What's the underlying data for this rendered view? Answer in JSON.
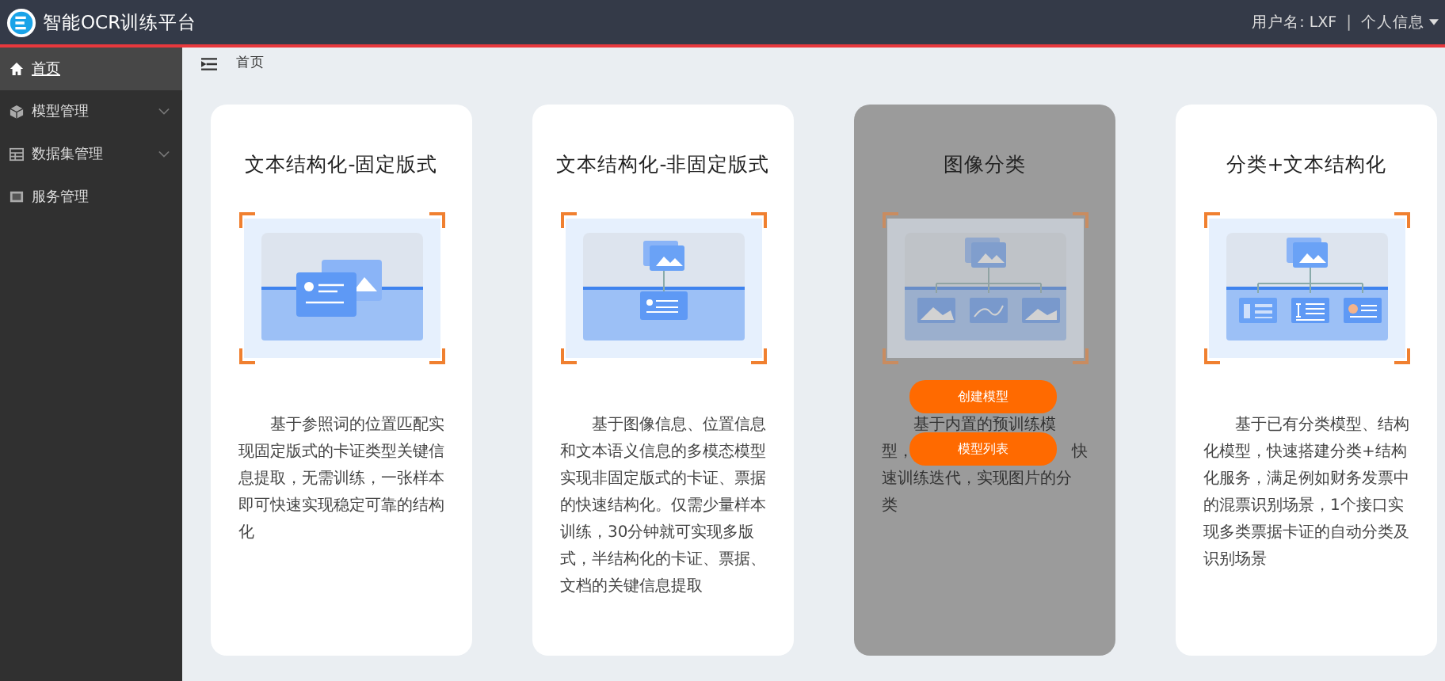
{
  "app": {
    "title": "智能OCR训练平台"
  },
  "user": {
    "name_label": "用户名: LXF",
    "separator": "|",
    "menu": "个人信息"
  },
  "sidebar": {
    "items": [
      {
        "label": "首页",
        "kind": "link",
        "selected": true
      },
      {
        "label": "模型管理",
        "kind": "group",
        "selected": false
      },
      {
        "label": "数据集管理",
        "kind": "group",
        "selected": false
      },
      {
        "label": "服务管理",
        "kind": "link",
        "selected": false
      }
    ]
  },
  "breadcrumb": [
    "首页"
  ],
  "cards": [
    {
      "title": "文本结构化-固定版式",
      "hovered": false,
      "description": "基于参照词的位置匹配实现固定版式的卡证类型关键信息提取，无需训练，一张样本即可快速实现稳定可靠的结构化"
    },
    {
      "title": "文本结构化-非固定版式",
      "hovered": false,
      "description": "基于图像信息、位置信息和文本语义信息的多模态模型实现非固定版式的卡证、票据的快速结构化。仅需少量样本训练，30分钟就可实现多版式，半结构化的卡证、票据、文档的关键信息提取"
    },
    {
      "title": "图像分类",
      "hovered": true,
      "description_lines": [
        [
          "基于内置的预训练模"
        ],
        [
          "型，",
          "快"
        ],
        [
          "速训练迭代，实现图片的分"
        ],
        [
          "类"
        ]
      ],
      "buttons": [
        "创建模型",
        "模型列表"
      ]
    },
    {
      "title": "分类+文本结构化",
      "hovered": false,
      "description": "基于已有分类模型、结构化模型，快速搭建分类+结构化服务，满足例如财务发票中的混票识别场景，1个接口实现多类票据卡证的自动分类及识别场景"
    }
  ]
}
